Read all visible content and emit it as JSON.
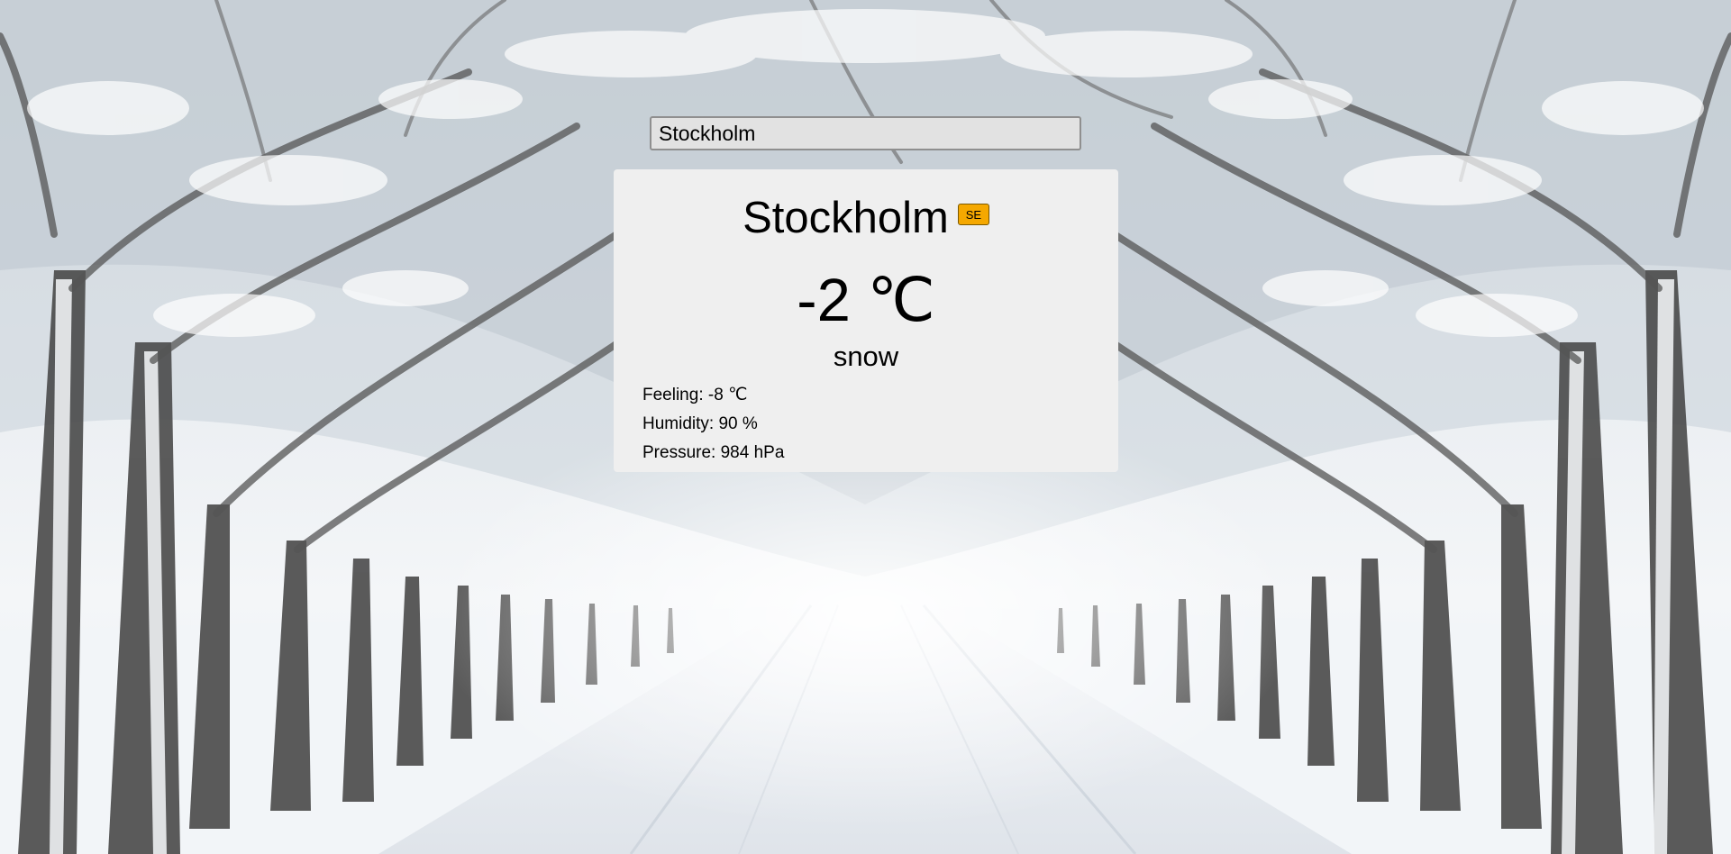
{
  "search": {
    "value": "Stockholm"
  },
  "weather": {
    "city": "Stockholm",
    "country_code": "SE",
    "temperature": "-2 ℃",
    "description": "snow",
    "feeling_label": "Feeling:",
    "feeling_value": "-8 ℃",
    "humidity_label": "Humidity:",
    "humidity_value": "90 %",
    "pressure_label": "Pressure:",
    "pressure_value": "984 hPa"
  },
  "colors": {
    "card_background": "#efefef",
    "badge_background": "#f5a800",
    "input_background": "#e2e2e2"
  }
}
